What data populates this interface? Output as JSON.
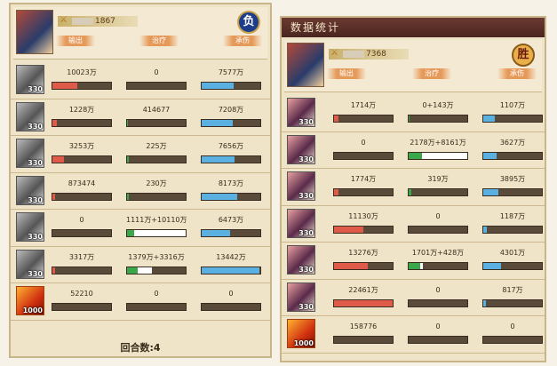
{
  "left": {
    "header": {
      "power_prefix": "",
      "power_suffix": "1867",
      "result": "负",
      "tabs": [
        "输出",
        "治疗",
        "承伤"
      ],
      "level": ""
    },
    "rows": [
      {
        "avatar": "gray",
        "level": "330",
        "output": "10023万",
        "output_frac": 0.42,
        "heal": "0",
        "heal_frac": 0,
        "heal2_frac": 0,
        "tank": "7577万",
        "tank_frac": 0.55
      },
      {
        "avatar": "gray",
        "level": "330",
        "output": "1228万",
        "output_frac": 0.08,
        "heal": "414677",
        "heal_frac": 0.02,
        "heal2_frac": 0,
        "tank": "7208万",
        "tank_frac": 0.53
      },
      {
        "avatar": "gray",
        "level": "330",
        "output": "3253万",
        "output_frac": 0.2,
        "heal": "225万",
        "heal_frac": 0.03,
        "heal2_frac": 0,
        "tank": "7656万",
        "tank_frac": 0.56
      },
      {
        "avatar": "gray",
        "level": "330",
        "output": "873474",
        "output_frac": 0.04,
        "heal": "230万",
        "heal_frac": 0.03,
        "heal2_frac": 0,
        "tank": "8173万",
        "tank_frac": 0.6
      },
      {
        "avatar": "gray",
        "level": "330",
        "output": "0",
        "output_frac": 0,
        "heal": "1111万+10110万",
        "heal_frac": 0.12,
        "heal2_frac": 0.88,
        "tank": "6473万",
        "tank_frac": 0.48
      },
      {
        "avatar": "gray",
        "level": "330",
        "output": "3317万",
        "output_frac": 0.05,
        "heal": "1379万+3316万",
        "heal_frac": 0.18,
        "heal2_frac": 0.25,
        "tank": "13442万",
        "tank_frac": 0.98
      },
      {
        "avatar": "pet",
        "level": "1000",
        "output": "52210",
        "output_frac": 0,
        "heal": "0",
        "heal_frac": 0,
        "heal2_frac": 0,
        "tank": "0",
        "tank_frac": 0
      }
    ],
    "footer": "回合数:4"
  },
  "right": {
    "title": "数据统计",
    "header": {
      "power_prefix": "",
      "power_suffix": "7368",
      "result": "胜",
      "tabs": [
        "输出",
        "治疗",
        "承伤"
      ]
    },
    "rows": [
      {
        "avatar": "color",
        "level": "330",
        "output": "1714万",
        "output_frac": 0.07,
        "heal": "0+143万",
        "heal_frac": 0.01,
        "heal2_frac": 0,
        "tank": "1107万",
        "tank_frac": 0.2
      },
      {
        "avatar": "color",
        "level": "330",
        "output": "0",
        "output_frac": 0,
        "heal": "2178万+8161万",
        "heal_frac": 0.22,
        "heal2_frac": 0.78,
        "tank": "3627万",
        "tank_frac": 0.22
      },
      {
        "avatar": "color",
        "level": "330",
        "output": "1774万",
        "output_frac": 0.07,
        "heal": "319万",
        "heal_frac": 0.05,
        "heal2_frac": 0,
        "tank": "3895万",
        "tank_frac": 0.25
      },
      {
        "avatar": "color",
        "level": "330",
        "output": "11130万",
        "output_frac": 0.5,
        "heal": "0",
        "heal_frac": 0,
        "heal2_frac": 0,
        "tank": "1187万",
        "tank_frac": 0.06
      },
      {
        "avatar": "color",
        "level": "330",
        "output": "13276万",
        "output_frac": 0.58,
        "heal": "1701万+428万",
        "heal_frac": 0.2,
        "heal2_frac": 0.05,
        "tank": "4301万",
        "tank_frac": 0.3
      },
      {
        "avatar": "color",
        "level": "330",
        "output": "22461万",
        "output_frac": 1.0,
        "heal": "0",
        "heal_frac": 0,
        "heal2_frac": 0,
        "tank": "817万",
        "tank_frac": 0.05
      },
      {
        "avatar": "pet",
        "level": "1000",
        "output": "158776",
        "output_frac": 0,
        "heal": "0",
        "heal_frac": 0,
        "heal2_frac": 0,
        "tank": "0",
        "tank_frac": 0
      }
    ]
  }
}
